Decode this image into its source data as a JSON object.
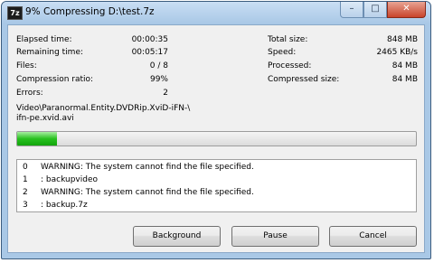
{
  "window": {
    "app_icon": "7z",
    "title": "9% Compressing D:\\test.7z",
    "minimize_glyph": "–",
    "maximize_glyph": "□",
    "close_glyph": "✕"
  },
  "stats_left": [
    {
      "label": "Elapsed time:",
      "value": "00:00:35"
    },
    {
      "label": "Remaining time:",
      "value": "00:05:17"
    },
    {
      "label": "Files:",
      "value": "0 / 8"
    },
    {
      "label": "Compression ratio:",
      "value": "99%"
    },
    {
      "label": "Errors:",
      "value": "2"
    }
  ],
  "stats_right": [
    {
      "label": "Total size:",
      "value": "848 MB"
    },
    {
      "label": "Speed:",
      "value": "2465 KB/s"
    },
    {
      "label": "Processed:",
      "value": "84 MB"
    },
    {
      "label": "Compressed size:",
      "value": "84 MB"
    }
  ],
  "current_file": {
    "line1": "Video\\Paranormal.Entity.DVDRip.XviD-iFN-\\",
    "line2": "ifn-pe.xvid.avi"
  },
  "progress": {
    "fraction": 0.1
  },
  "log": [
    {
      "index": "0",
      "message": "WARNING: The system cannot find the file specified."
    },
    {
      "index": "1",
      "message": ": backupvideo"
    },
    {
      "index": "2",
      "message": "WARNING: The system cannot find the file specified."
    },
    {
      "index": "3",
      "message": ": backup.7z"
    }
  ],
  "buttons": {
    "background": "Background",
    "pause": "Pause",
    "cancel": "Cancel"
  }
}
